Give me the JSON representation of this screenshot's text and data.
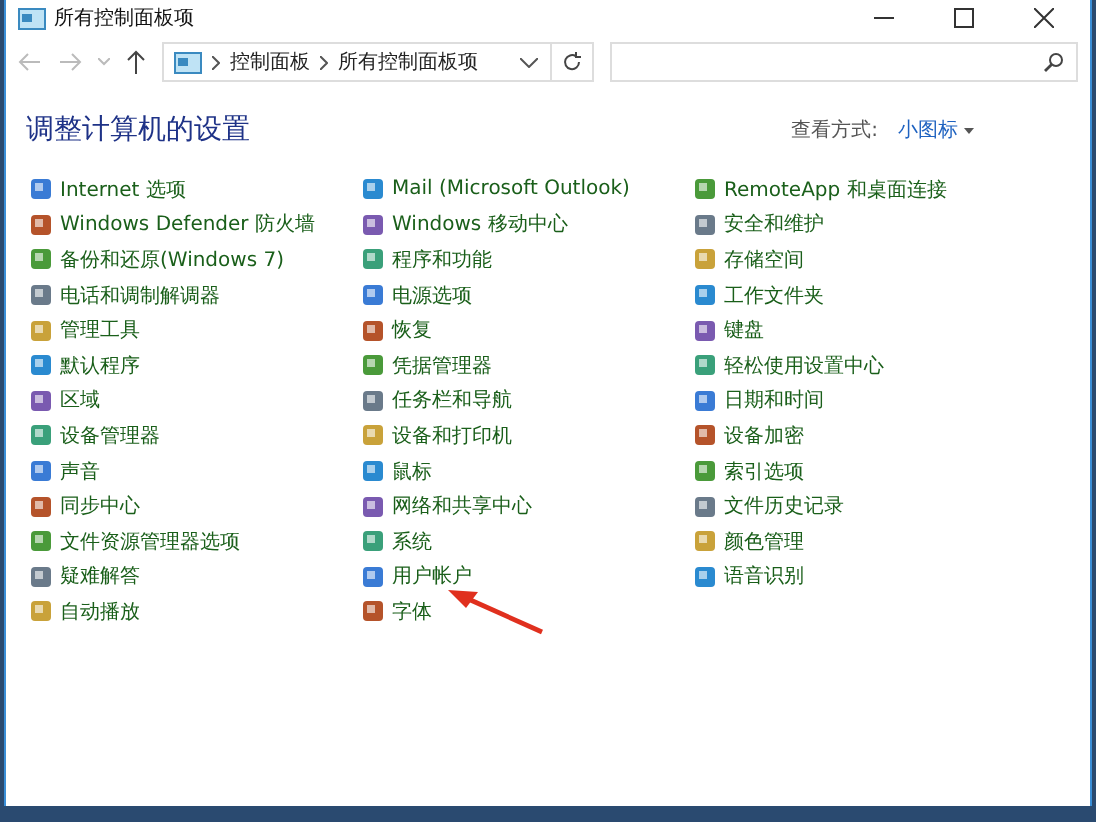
{
  "window": {
    "title": "所有控制面板项"
  },
  "address_bar": {
    "path": [
      "控制面板",
      "所有控制面板项"
    ]
  },
  "heading": "调整计算机的设置",
  "view_by": {
    "label": "查看方式:",
    "value": "小图标"
  },
  "columns": [
    [
      "Internet 选项",
      "Windows Defender 防火墙",
      "备份和还原(Windows 7)",
      "电话和调制解调器",
      "管理工具",
      "默认程序",
      "区域",
      "设备管理器",
      "声音",
      "同步中心",
      "文件资源管理器选项",
      "疑难解答",
      "自动播放"
    ],
    [
      "Mail (Microsoft Outlook)",
      "Windows 移动中心",
      "程序和功能",
      "电源选项",
      "恢复",
      "凭据管理器",
      "任务栏和导航",
      "设备和打印机",
      "鼠标",
      "网络和共享中心",
      "系统",
      "用户帐户",
      "字体"
    ],
    [
      "RemoteApp 和桌面连接",
      "安全和维护",
      "存储空间",
      "工作文件夹",
      "键盘",
      "轻松使用设置中心",
      "日期和时间",
      "设备加密",
      "索引选项",
      "文件历史记录",
      "颜色管理",
      "语音识别"
    ]
  ]
}
